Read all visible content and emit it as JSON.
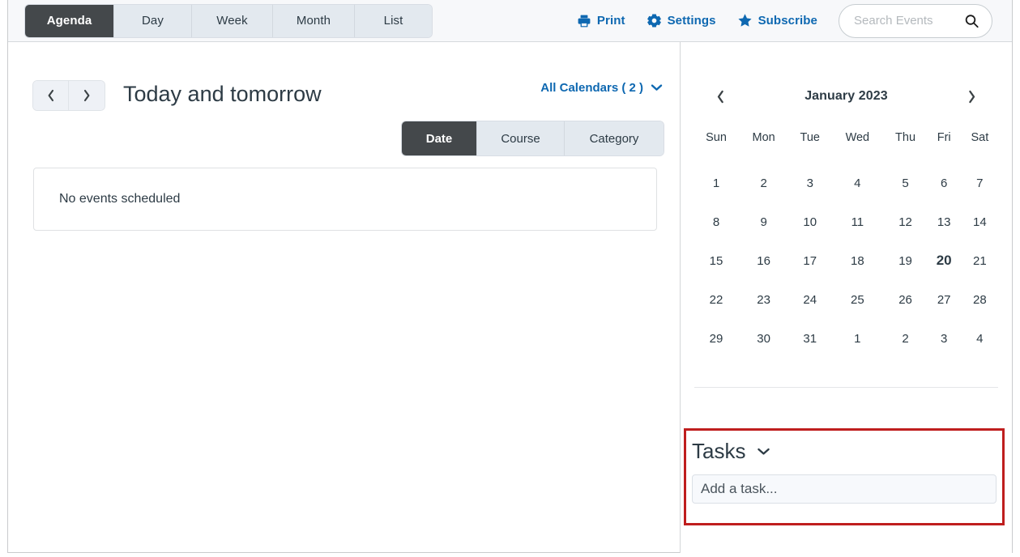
{
  "topbar": {
    "view_tabs": [
      {
        "label": "Agenda",
        "active": true
      },
      {
        "label": "Day",
        "active": false
      },
      {
        "label": "Week",
        "active": false
      },
      {
        "label": "Month",
        "active": false
      },
      {
        "label": "List",
        "active": false
      }
    ],
    "actions": [
      {
        "label": "Print",
        "icon": "printer-icon"
      },
      {
        "label": "Settings",
        "icon": "gear-icon"
      },
      {
        "label": "Subscribe",
        "icon": "star-icon"
      }
    ],
    "search": {
      "value": "",
      "placeholder": "Search Events",
      "icon": "search-icon"
    }
  },
  "main": {
    "prev_label": "‹",
    "next_label": "›",
    "title": "Today and tomorrow",
    "calendars_filter": {
      "label": "All Calendars ( 2 )",
      "icon": "chevron-down-icon"
    },
    "group_tabs": [
      {
        "label": "Date",
        "active": true
      },
      {
        "label": "Course",
        "active": false
      },
      {
        "label": "Category",
        "active": false
      }
    ],
    "events_empty_message": "No events scheduled"
  },
  "sidebar": {
    "mini_calendar": {
      "month_label": "January 2023",
      "prev_icon": "chevron-left-icon",
      "next_icon": "chevron-right-icon",
      "weekdays": [
        "Sun",
        "Mon",
        "Tue",
        "Wed",
        "Thu",
        "Fri",
        "Sat"
      ],
      "weeks": [
        [
          {
            "day": "1",
            "today": false
          },
          {
            "day": "2",
            "today": false
          },
          {
            "day": "3",
            "today": false
          },
          {
            "day": "4",
            "today": false
          },
          {
            "day": "5",
            "today": false
          },
          {
            "day": "6",
            "today": false
          },
          {
            "day": "7",
            "today": false
          }
        ],
        [
          {
            "day": "8",
            "today": false
          },
          {
            "day": "9",
            "today": false
          },
          {
            "day": "10",
            "today": false
          },
          {
            "day": "11",
            "today": false
          },
          {
            "day": "12",
            "today": false
          },
          {
            "day": "13",
            "today": false
          },
          {
            "day": "14",
            "today": false
          }
        ],
        [
          {
            "day": "15",
            "today": false
          },
          {
            "day": "16",
            "today": false
          },
          {
            "day": "17",
            "today": false
          },
          {
            "day": "18",
            "today": false
          },
          {
            "day": "19",
            "today": false
          },
          {
            "day": "20",
            "today": true
          },
          {
            "day": "21",
            "today": false
          }
        ],
        [
          {
            "day": "22",
            "today": false
          },
          {
            "day": "23",
            "today": false
          },
          {
            "day": "24",
            "today": false
          },
          {
            "day": "25",
            "today": false
          },
          {
            "day": "26",
            "today": false
          },
          {
            "day": "27",
            "today": false
          },
          {
            "day": "28",
            "today": false
          }
        ],
        [
          {
            "day": "29",
            "today": false
          },
          {
            "day": "30",
            "today": false
          },
          {
            "day": "31",
            "today": false
          },
          {
            "day": "1",
            "today": false
          },
          {
            "day": "2",
            "today": false
          },
          {
            "day": "3",
            "today": false
          },
          {
            "day": "4",
            "today": false
          }
        ]
      ]
    },
    "tasks": {
      "title": "Tasks",
      "toggle_icon": "chevron-down-icon",
      "input_value": "",
      "input_placeholder": "Add a task...",
      "highlight_color": "#bf1e1e"
    }
  },
  "colors": {
    "accent_blue": "#0e68b1",
    "tab_active_bg": "#44484b",
    "tab_inactive_bg": "#e3e9ef",
    "text": "#2d3b45",
    "highlight_red": "#bf1e1e"
  }
}
